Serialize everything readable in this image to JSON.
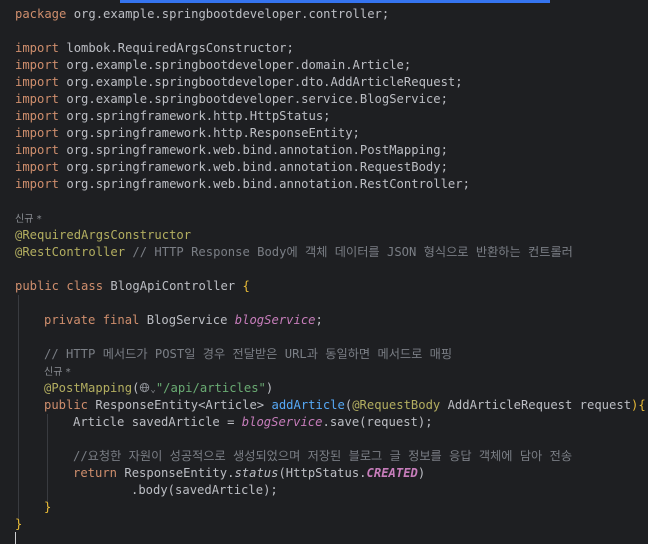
{
  "editor": {
    "lines": [
      {
        "id": "package",
        "parts": [
          {
            "t": "package ",
            "c": "kw"
          },
          {
            "t": "org.example.springbootdeveloper.controller;",
            "c": "pkg"
          }
        ]
      },
      {
        "id": "blank1",
        "parts": []
      },
      {
        "id": "import1",
        "parts": [
          {
            "t": "import ",
            "c": "kw"
          },
          {
            "t": "lombok.RequiredArgsConstructor;",
            "c": "pkg"
          }
        ]
      },
      {
        "id": "import2",
        "parts": [
          {
            "t": "import ",
            "c": "kw"
          },
          {
            "t": "org.example.springbootdeveloper.domain.Article;",
            "c": "pkg"
          }
        ]
      },
      {
        "id": "import3",
        "parts": [
          {
            "t": "import ",
            "c": "kw"
          },
          {
            "t": "org.example.springbootdeveloper.dto.AddArticleRequest;",
            "c": "pkg"
          }
        ]
      },
      {
        "id": "import4",
        "parts": [
          {
            "t": "import ",
            "c": "kw"
          },
          {
            "t": "org.example.springbootdeveloper.service.BlogService;",
            "c": "pkg"
          }
        ]
      },
      {
        "id": "import5",
        "parts": [
          {
            "t": "import ",
            "c": "kw"
          },
          {
            "t": "org.springframework.http.HttpStatus;",
            "c": "pkg"
          }
        ]
      },
      {
        "id": "import6",
        "parts": [
          {
            "t": "import ",
            "c": "kw"
          },
          {
            "t": "org.springframework.http.ResponseEntity;",
            "c": "pkg"
          }
        ]
      },
      {
        "id": "import7",
        "parts": [
          {
            "t": "import ",
            "c": "kw"
          },
          {
            "t": "org.springframework.web.bind.annotation.PostMapping;",
            "c": "pkg"
          }
        ]
      },
      {
        "id": "import8",
        "parts": [
          {
            "t": "import ",
            "c": "kw"
          },
          {
            "t": "org.springframework.web.bind.annotation.RequestBody;",
            "c": "pkg"
          }
        ]
      },
      {
        "id": "import9",
        "parts": [
          {
            "t": "import ",
            "c": "kw"
          },
          {
            "t": "org.springframework.web.bind.annotation.RestController;",
            "c": "pkg"
          }
        ]
      },
      {
        "id": "blank2",
        "parts": []
      },
      {
        "id": "hint1",
        "hint": "신규 *"
      },
      {
        "id": "anno1",
        "parts": [
          {
            "t": "@RequiredArgsConstructor",
            "c": "anno"
          }
        ]
      },
      {
        "id": "anno2",
        "parts": [
          {
            "t": "@RestController",
            "c": "anno"
          },
          {
            "t": " // HTTP Response Body에 객체 데이터를 JSON 형식으로 반환하는 컨트롤러",
            "c": "cmt"
          }
        ]
      },
      {
        "id": "blank3",
        "parts": []
      },
      {
        "id": "classdecl",
        "parts": [
          {
            "t": "public class ",
            "c": "kw"
          },
          {
            "t": "BlogApiController ",
            "c": "pkg"
          },
          {
            "t": "{",
            "c": "brace"
          }
        ]
      },
      {
        "id": "blank4",
        "parts": []
      },
      {
        "id": "fielddecl",
        "indent": "ind1",
        "parts": [
          {
            "t": "private final ",
            "c": "kw"
          },
          {
            "t": "BlogService ",
            "c": "pkg"
          },
          {
            "t": "blogService",
            "c": "field"
          },
          {
            "t": ";",
            "c": "pkg"
          }
        ]
      },
      {
        "id": "blank5",
        "parts": []
      },
      {
        "id": "cmt2",
        "indent": "ind1",
        "parts": [
          {
            "t": "// HTTP 메서드가 POST일 경우 전달받은 URL과 동일하면 메서드로 매핑",
            "c": "cmt"
          }
        ]
      },
      {
        "id": "hint2",
        "indent": "ind1",
        "hint": "신규 *"
      },
      {
        "id": "postmap",
        "indent": "ind1",
        "parts": [
          {
            "t": "@PostMapping",
            "c": "anno"
          },
          {
            "t": "(",
            "c": "pkg"
          },
          {
            "t": "@globe"
          },
          {
            "t": "\"/api/articles\"",
            "c": "str"
          },
          {
            "t": ")",
            "c": "pkg"
          }
        ]
      },
      {
        "id": "method",
        "indent": "ind1",
        "parts": [
          {
            "t": "public ",
            "c": "kw"
          },
          {
            "t": "ResponseEntity<Article> ",
            "c": "pkg"
          },
          {
            "t": "addArticle",
            "c": "fn"
          },
          {
            "t": "(",
            "c": "pkg"
          },
          {
            "t": "@RequestBody ",
            "c": "anno"
          },
          {
            "t": "AddArticleRequest request",
            "c": "pkg"
          },
          {
            "t": "){",
            "c": "brace"
          }
        ]
      },
      {
        "id": "stmt1",
        "indent": "ind2",
        "parts": [
          {
            "t": "Article savedArticle = ",
            "c": "pkg"
          },
          {
            "t": "blogService",
            "c": "field"
          },
          {
            "t": ".save(request);",
            "c": "pkg"
          }
        ]
      },
      {
        "id": "blank6",
        "parts": []
      },
      {
        "id": "cmt3",
        "indent": "ind2",
        "parts": [
          {
            "t": "//요청한 자원이 성공적으로 생성되었으며 저장된 블로그 글 정보를 응답 객체에 담아 전송",
            "c": "cmt"
          }
        ]
      },
      {
        "id": "ret",
        "indent": "ind2",
        "parts": [
          {
            "t": "return ",
            "c": "kw"
          },
          {
            "t": "ResponseEntity.",
            "c": "pkg"
          },
          {
            "t": "status",
            "c": "staticfn"
          },
          {
            "t": "(HttpStatus.",
            "c": "pkg"
          },
          {
            "t": "CREATED",
            "c": "const"
          },
          {
            "t": ")",
            "c": "pkg"
          }
        ]
      },
      {
        "id": "body",
        "indent": "ind3",
        "parts": [
          {
            "t": ".body(savedArticle);",
            "c": "pkg"
          }
        ]
      },
      {
        "id": "close1",
        "indent": "ind1",
        "parts": [
          {
            "t": "}",
            "c": "brace"
          }
        ]
      },
      {
        "id": "close2",
        "parts": [
          {
            "t": "}",
            "c": "brace"
          }
        ]
      }
    ]
  }
}
